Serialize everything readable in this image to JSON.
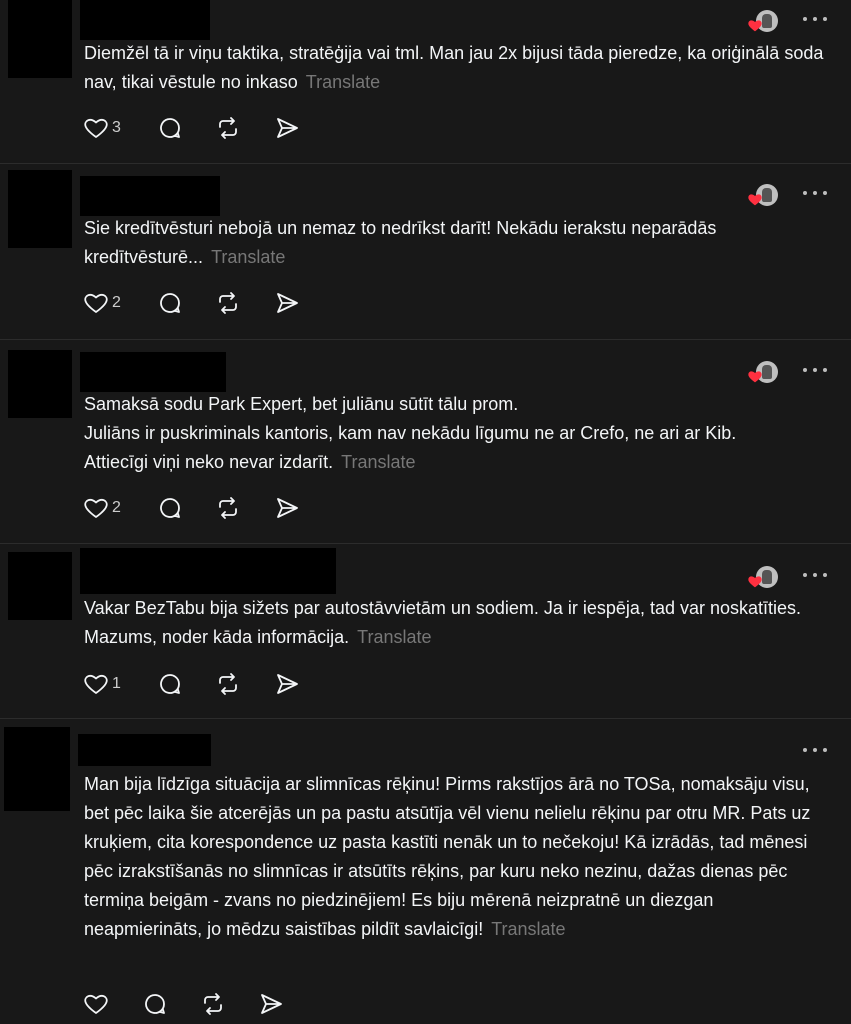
{
  "translate_label": "Translate",
  "colors": {
    "background": "#181818",
    "text": "#f3f5f7",
    "muted": "#777777",
    "heart": "#ff3040",
    "divider": "#2c2c2c"
  },
  "icons": [
    "heart-icon",
    "comment-icon",
    "repost-icon",
    "share-icon",
    "more-icon",
    "liked-heart-icon"
  ],
  "posts": [
    {
      "text": "Diemžēl tā ir viņu taktika, stratēģija vai tml. Man jau 2x bijusi tāda pieredze, ka oriģinālā soda nav, tikai vēstule no inkaso",
      "likes": "3",
      "liked_by_author": true
    },
    {
      "text": "Sie kredītvēsturi nebojā un nemaz to nedrīkst darīt! Nekādu ierakstu neparādās kredītvēsturē...",
      "likes": "2",
      "liked_by_author": true
    },
    {
      "text": "Samaksā sodu Park Expert, bet juliānu sūtīt tālu prom.\nJuliāns ir puskriminals kantoris, kam nav nekādu līgumu ne ar Crefo, ne ari ar Kib.\nAttiecīgi viņi neko nevar izdarīt.",
      "likes": "2",
      "liked_by_author": true
    },
    {
      "text": "Vakar BezTabu bija sižets par autostāvvietām un sodiem. Ja ir iespēja, tad var noskatīties. Mazums, noder kāda informācija.",
      "likes": "1",
      "liked_by_author": true
    },
    {
      "text": "Man bija līdzīga situācija ar slimnīcas rēķinu! Pirms rakstījos ārā no TOSa, nomaksāju visu, bet pēc laika šie atcerējās un pa pastu atsūtīja vēl vienu nelielu rēķinu par otru MR. Pats uz kruķiem, cita korespondence uz pasta kastīti nenāk un to nečekoju! Kā izrādās, tad mēnesi pēc izrakstīšanās no slimnīcas ir atsūtīts rēķins, par kuru neko nezinu, dažas dienas pēc termiņa beigām - zvans no piedzinējiem! Es biju mērenā neizpratnē un diezgan neapmierināts, jo mēdzu saistības pildīt savlaicīgi!",
      "likes": "",
      "liked_by_author": false
    }
  ]
}
